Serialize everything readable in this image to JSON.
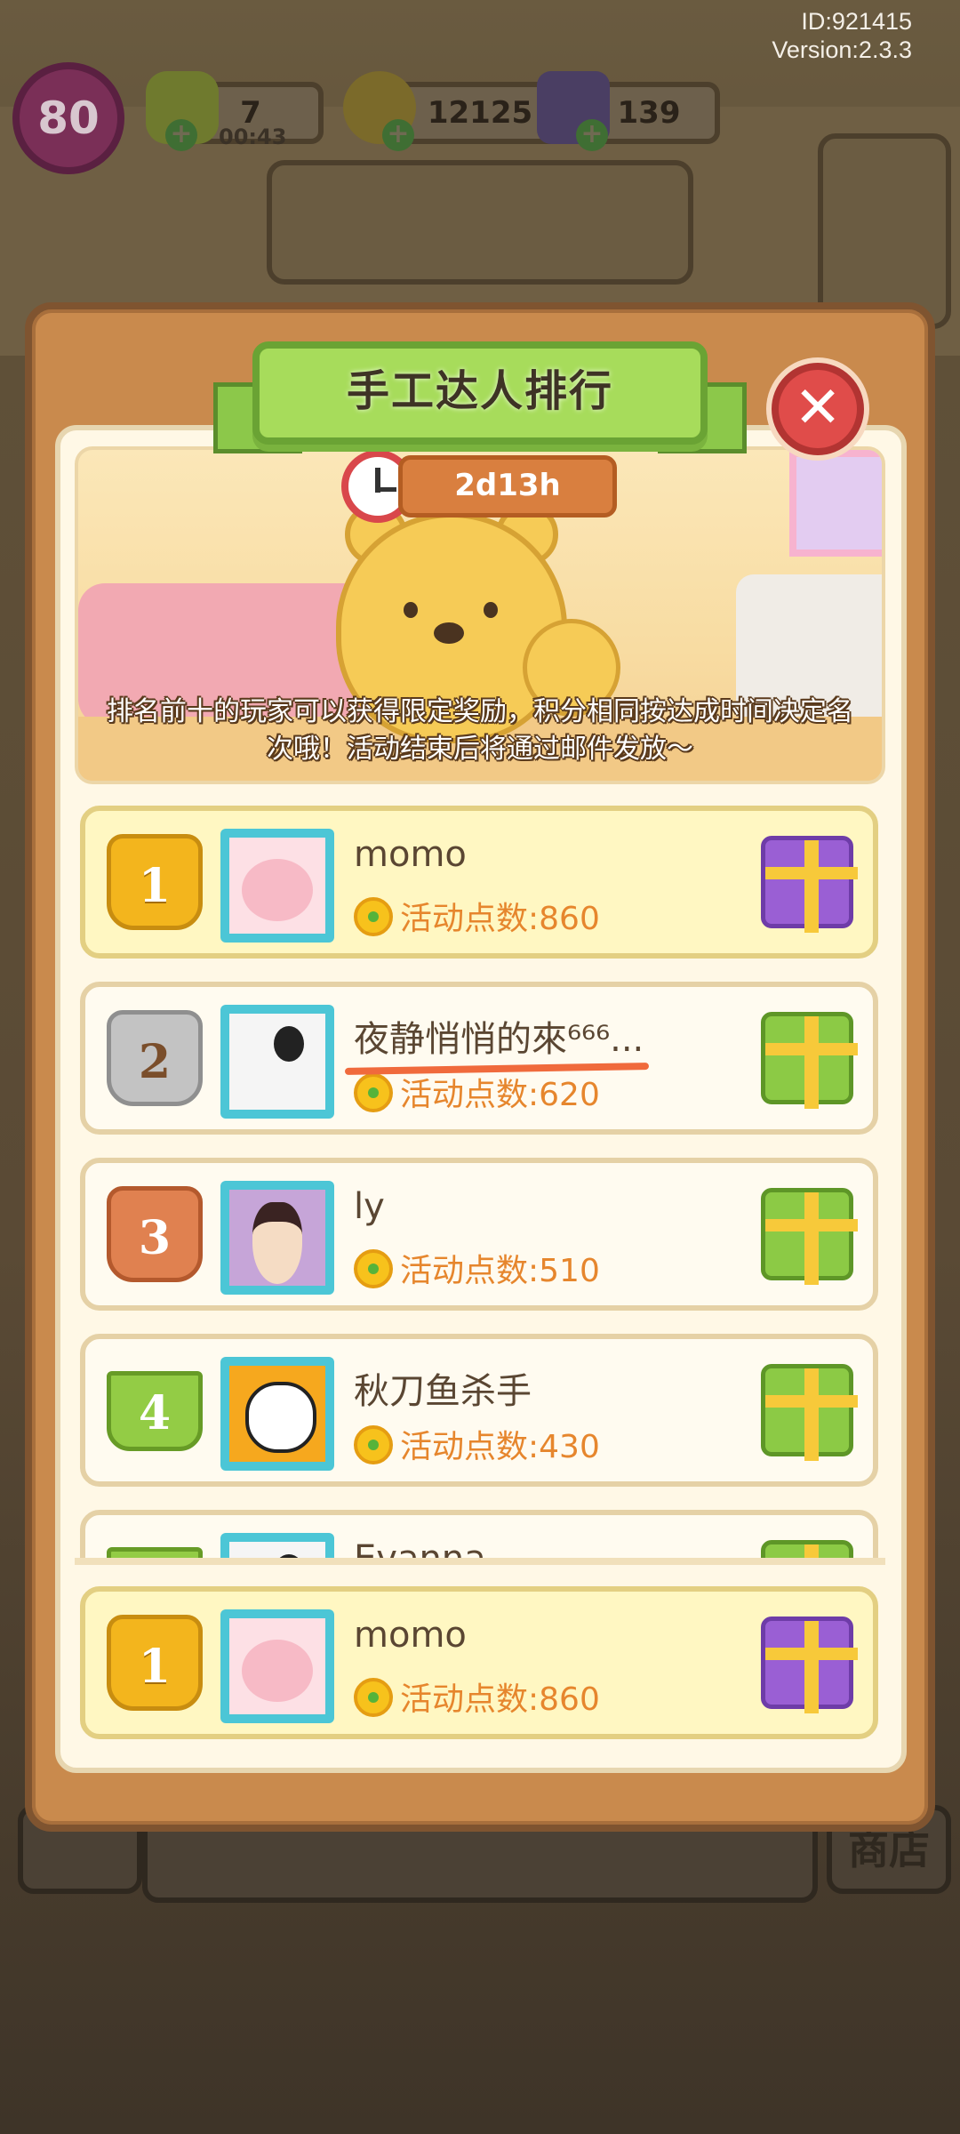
{
  "system": {
    "id_text": "ID:921415",
    "version_text": "Version:2.3.3"
  },
  "hud": {
    "level": "80",
    "energy": "7",
    "energy_timer": "00:43",
    "coins": "12125",
    "gems": "139"
  },
  "background": {
    "shop_label": "商店"
  },
  "modal": {
    "title": "手工达人排行",
    "countdown": "2d13h",
    "info": "排名前十的玩家可以获得限定奖励，积分相同按达成时间决定名次哦！活动结束后将通过邮件发放～",
    "points_prefix": "活动点数:"
  },
  "rankings": [
    {
      "rank": "1",
      "name": "momo",
      "points": "活动点数:860",
      "avatar": "pink-creature",
      "gift": "purple"
    },
    {
      "rank": "2",
      "name": "夜静悄悄的來⁶⁶⁶...",
      "points": "活动点数:620",
      "avatar": "panda-photo",
      "gift": "green"
    },
    {
      "rank": "3",
      "name": "ly",
      "points": "活动点数:510",
      "avatar": "anime-boy",
      "gift": "green"
    },
    {
      "rank": "4",
      "name": "秋刀鱼杀手",
      "points": "活动点数:430",
      "avatar": "white-cat",
      "gift": "green"
    },
    {
      "rank": "",
      "name": "Evanna",
      "points": "",
      "avatar": "photo",
      "gift": "green"
    }
  ],
  "my_rank": {
    "rank": "1",
    "name": "momo",
    "points": "活动点数:860",
    "avatar": "pink-creature",
    "gift": "purple"
  },
  "colors": {
    "modal_frame": "#c98a4d",
    "title_ribbon": "#a7dc5b",
    "close_button": "#e04c4a",
    "points_text": "#e6862d",
    "annotation_underline": "#f06a3c"
  }
}
